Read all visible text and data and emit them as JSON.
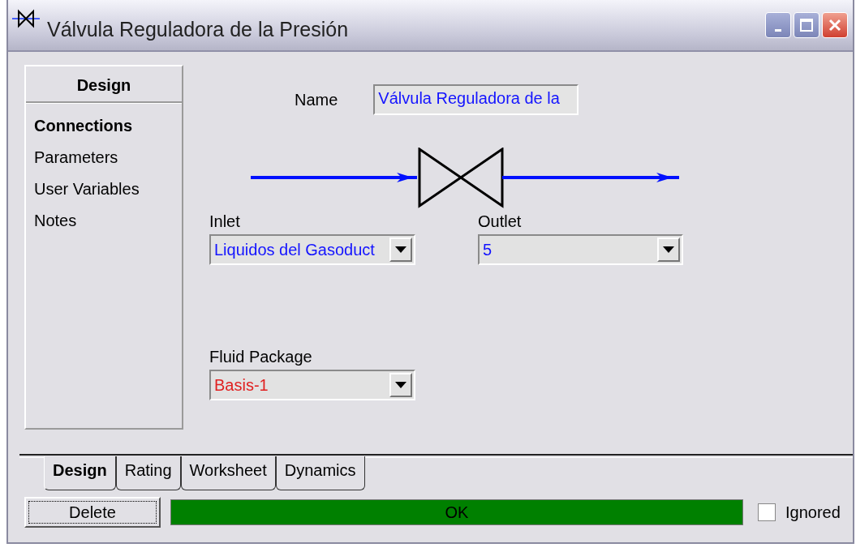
{
  "window": {
    "title": "Válvula Reguladora de la Presión"
  },
  "sidebar": {
    "header": "Design",
    "items": [
      {
        "label": "Connections",
        "selected": true
      },
      {
        "label": "Parameters",
        "selected": false
      },
      {
        "label": "User Variables",
        "selected": false
      },
      {
        "label": "Notes",
        "selected": false
      }
    ]
  },
  "name": {
    "label": "Name",
    "value": "Válvula Reguladora de la"
  },
  "inlet": {
    "label": "Inlet",
    "value": "Liquidos del Gasoduct"
  },
  "outlet": {
    "label": "Outlet",
    "value": "5"
  },
  "fluid_package": {
    "label": "Fluid Package",
    "value": "Basis-1"
  },
  "tabs": [
    {
      "label": "Design",
      "selected": true
    },
    {
      "label": "Rating",
      "selected": false
    },
    {
      "label": "Worksheet",
      "selected": false
    },
    {
      "label": "Dynamics",
      "selected": false
    }
  ],
  "delete_button": "Delete",
  "status": "OK",
  "ignored": {
    "label": "Ignored",
    "checked": false
  }
}
